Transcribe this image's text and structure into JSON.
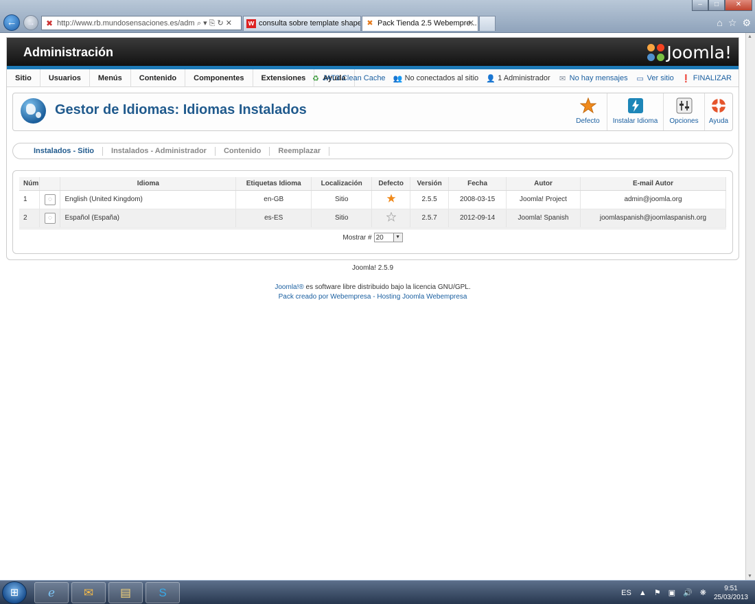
{
  "browser": {
    "address_url": "http://www.rb.mundosensaciones.es/adm",
    "tabs": [
      {
        "label": "consulta sobre template shape..."
      },
      {
        "label": "Pack Tienda 2.5 Webempre..."
      }
    ]
  },
  "header": {
    "title": "Administración",
    "logo_text": "Joomla!"
  },
  "menu": {
    "items": [
      "Sitio",
      "Usuarios",
      "Menús",
      "Contenido",
      "Componentes",
      "Extensiones",
      "Ayuda"
    ]
  },
  "status": {
    "cache": "JAT3 Clean Cache",
    "visitors": "No conectados al sitio",
    "admins": "1 Administrador",
    "messages": "No hay mensajes",
    "view_site": "Ver sitio",
    "logout": "FINALIZAR"
  },
  "toolbar": {
    "page_title": "Gestor de Idiomas: Idiomas Instalados",
    "buttons": {
      "defecto": "Defecto",
      "instalar": "Instalar Idioma",
      "opciones": "Opciones",
      "ayuda": "Ayuda"
    }
  },
  "subnav": {
    "items": [
      {
        "label": "Instalados - Sitio",
        "active": true
      },
      {
        "label": "Instalados - Administrador",
        "active": false
      },
      {
        "label": "Contenido",
        "active": false
      },
      {
        "label": "Reemplazar",
        "active": false
      }
    ]
  },
  "table": {
    "headers": {
      "num": "Núm",
      "idioma": "Idioma",
      "etiquetas": "Etiquetas Idioma",
      "localizacion": "Localización",
      "defecto": "Defecto",
      "version": "Versión",
      "fecha": "Fecha",
      "autor": "Autor",
      "email": "E-mail Autor"
    },
    "rows": [
      {
        "num": "1",
        "idioma": "English (United Kingdom)",
        "tag": "en-GB",
        "location": "Sitio",
        "is_default": true,
        "version": "2.5.5",
        "date": "2008-03-15",
        "author": "Joomla! Project",
        "email": "admin@joomla.org"
      },
      {
        "num": "2",
        "idioma": "Español (España)",
        "tag": "es-ES",
        "location": "Sitio",
        "is_default": false,
        "version": "2.5.7",
        "date": "2012-09-14",
        "author": "Joomla! Spanish",
        "email": "joomlaspanish@joomlaspanish.org"
      }
    ],
    "limit_label": "Mostrar #",
    "limit_value": "20"
  },
  "footer": {
    "version": "Joomla! 2.5.9",
    "license_link": "Joomla!®",
    "license_text": " es software libre distribuido bajo la licencia GNU/GPL.",
    "pack_link": "Pack creado por Webempresa",
    "separator": " - ",
    "hosting_link": "Hosting Joomla Webempresa"
  },
  "taskbar": {
    "language": "ES",
    "time": "9:51",
    "date": "25/03/2013"
  },
  "colors": {
    "accent": "#1d7ab7",
    "title": "#205a8d",
    "link": "#1a5fa0",
    "default_star": "#f08a1c"
  }
}
